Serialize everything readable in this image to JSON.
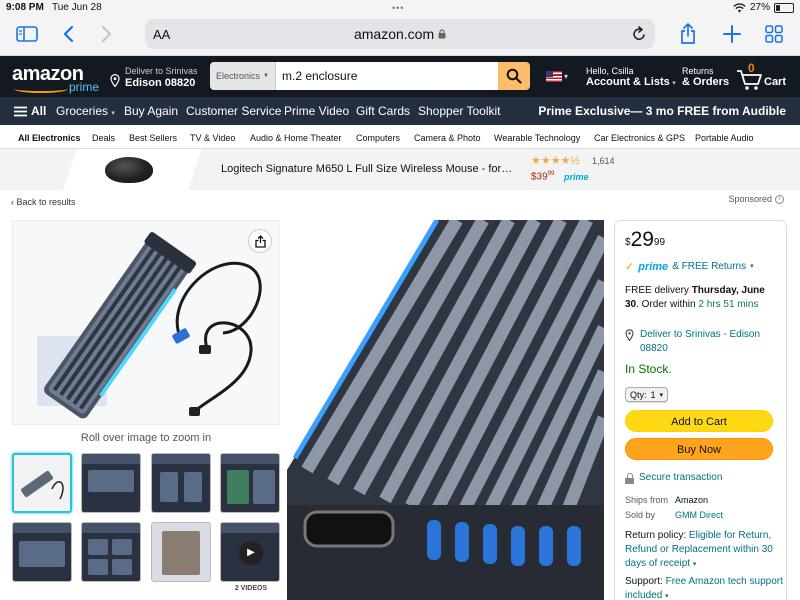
{
  "colors": {
    "amazon_dark": "#131921",
    "amazon_nav": "#232f3e",
    "search_button": "#febd69",
    "add_to_cart": "#ffd814",
    "buy_now": "#ffa41c",
    "link": "#007185",
    "in_stock": "#007600",
    "prime_blue": "#00a8e1"
  },
  "status_bar": {
    "time": "9:08 PM",
    "date": "Tue Jun 28",
    "battery": "27%",
    "battery_level": 0.27
  },
  "safari": {
    "text_size": "AA",
    "url": "amazon.com"
  },
  "header": {
    "logo_text": "amazon",
    "logo_prime": "prime",
    "deliver_line1": "Deliver to Srinivas",
    "deliver_line2": "Edison 08820",
    "search_category": "Electronics",
    "search_query": "m.2 enclosure",
    "account_line1": "Hello, Csilla",
    "account_line2": "Account & Lists",
    "orders_line1": "Returns",
    "orders_line2": "& Orders",
    "cart_count": "0",
    "cart_label": "Cart"
  },
  "nav": {
    "all": "All",
    "items": [
      "Groceries",
      "Buy Again",
      "Customer Service",
      "Prime Video",
      "Gift Cards",
      "Shopper Toolkit"
    ],
    "promo": "Prime Exclusive— 3 mo FREE from Audible"
  },
  "categories": [
    "All Electronics",
    "Deals",
    "Best Sellers",
    "TV & Video",
    "Audio & Home Theater",
    "Computers",
    "Camera & Photo",
    "Wearable Technology",
    "Car Electronics & GPS",
    "Portable Audio"
  ],
  "ad": {
    "title": "Logitech Signature M650 L Full Size Wireless Mouse - for…",
    "stars": "★★★★½",
    "rating": 4.5,
    "review_count": "1,614",
    "price_dollars": "$39",
    "price_cents": "99",
    "prime": "prime"
  },
  "back_link": "‹ Back to results",
  "sponsored": "Sponsored",
  "gallery": {
    "zoom_hint": "Roll over image to zoom in",
    "videos_label": "2 VIDEOS",
    "thumbnail_count": 8
  },
  "buybox": {
    "price_symbol": "$",
    "price_dollars": "29",
    "price_cents": "99",
    "prime": "prime",
    "returns": "& FREE Returns",
    "delivery_prefix": "FREE delivery ",
    "delivery_date": "Thursday, June 30",
    "delivery_mid": ". Order within ",
    "delivery_window": "2 hrs 51 mins",
    "deliver_to": "Deliver to Srinivas - Edison 08820",
    "stock": "In Stock.",
    "qty_label": "Qty:",
    "qty_value": "1",
    "add_to_cart": "Add to Cart",
    "buy_now": "Buy Now",
    "secure": "Secure transaction",
    "ships_from_label": "Ships from",
    "ships_from": "Amazon",
    "sold_by_label": "Sold by",
    "sold_by": "GMM Direct",
    "return_label": "Return policy: ",
    "return_link": "Eligible for Return, Refund or Replacement within 30 days of receipt",
    "support_label": "Support: ",
    "support_link": "Free Amazon tech support included"
  }
}
